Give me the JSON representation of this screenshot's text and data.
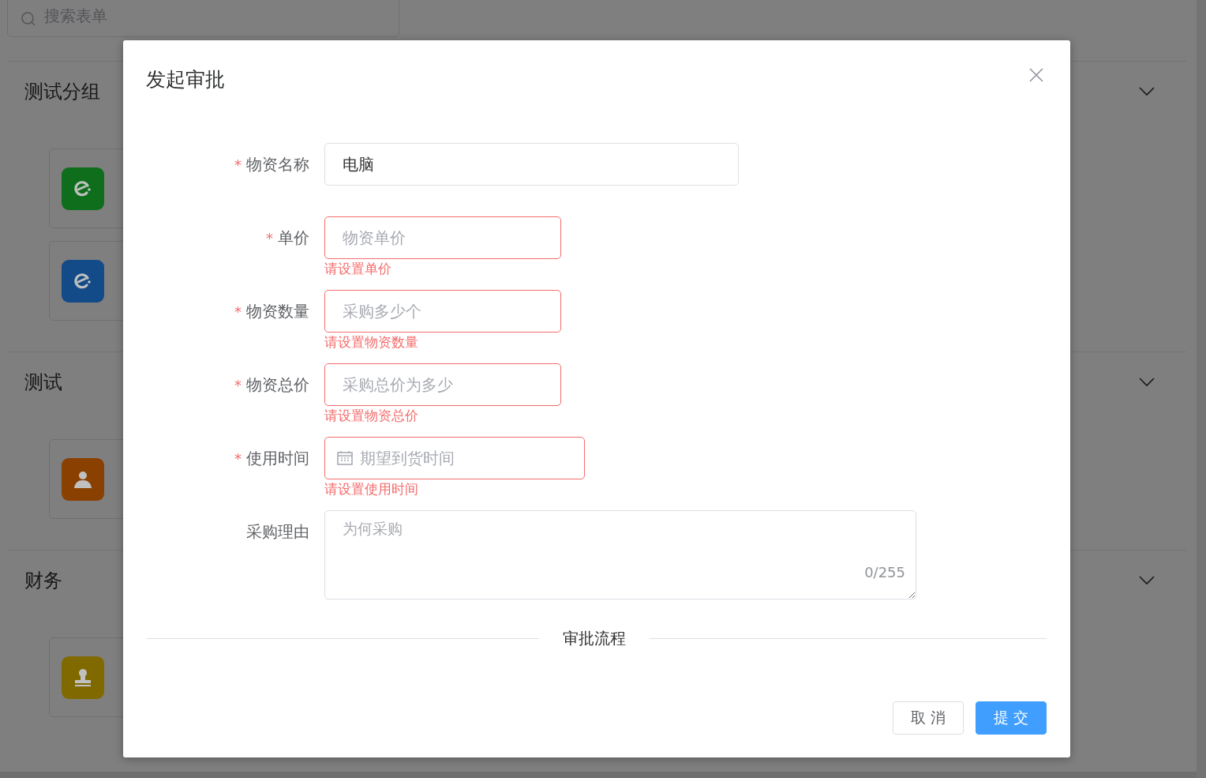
{
  "background": {
    "search": {
      "placeholder": "搜索表单"
    },
    "groups": [
      {
        "title": "测试分组",
        "cards": [
          {
            "kind": "app",
            "color": "#0f6e1c"
          },
          {
            "kind": "app",
            "color": "#134a88"
          }
        ]
      },
      {
        "title": "测试",
        "cards": [
          {
            "kind": "user",
            "color": "#8a4000"
          }
        ]
      },
      {
        "title": "财务",
        "cards": [
          {
            "kind": "stamp",
            "color": "#806a00"
          }
        ]
      }
    ]
  },
  "dialog": {
    "title": "发起审批",
    "fields": [
      {
        "kind": "input",
        "marker": "*",
        "label": "物资名称",
        "value": "电脑",
        "invalid": false
      },
      {
        "kind": "input",
        "marker": "*",
        "label": "单价",
        "placeholder": "物资单价",
        "invalid": true,
        "error": "请设置单价"
      },
      {
        "kind": "input",
        "marker": "*",
        "label": "物资数量",
        "placeholder": "采购多少个",
        "invalid": true,
        "error": "请设置物资数量"
      },
      {
        "kind": "input",
        "marker": "*",
        "label": "物资总价",
        "placeholder": "采购总价为多少",
        "invalid": true,
        "error": "请设置物资总价"
      },
      {
        "kind": "date",
        "marker": "*",
        "label": "使用时间",
        "placeholder": "期望到货时间",
        "invalid": true,
        "error": "请设置使用时间"
      },
      {
        "kind": "textarea",
        "label": "采购理由",
        "placeholder": "为何采购",
        "counter": "0/255",
        "invalid": false
      }
    ],
    "section": "审批流程",
    "buttons": [
      {
        "label": "取 消",
        "kind": "default"
      },
      {
        "label": "提 交",
        "kind": "primary"
      }
    ]
  }
}
